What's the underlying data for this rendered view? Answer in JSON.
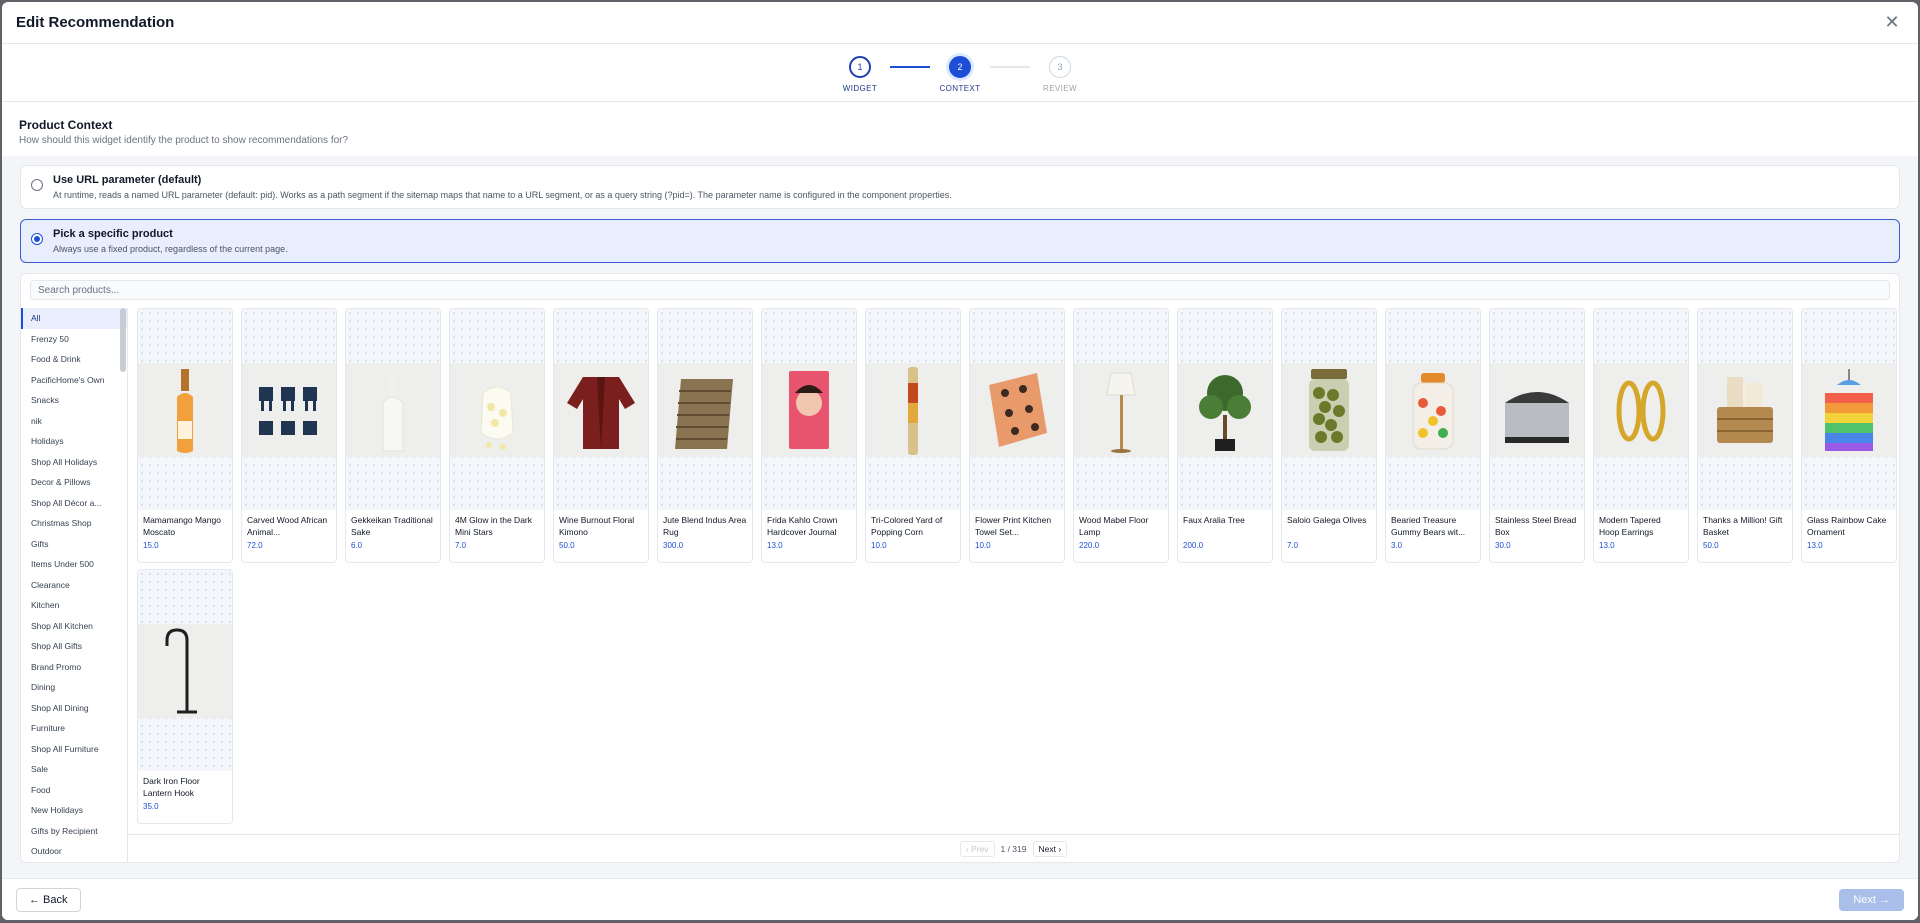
{
  "modal": {
    "title": "Edit Recommendation",
    "close_icon": "close-icon"
  },
  "stepper": {
    "steps": [
      {
        "number": "1",
        "label": "WIDGET",
        "state": "done"
      },
      {
        "number": "2",
        "label": "CONTEXT",
        "state": "active"
      },
      {
        "number": "3",
        "label": "REVIEW",
        "state": "pending"
      }
    ]
  },
  "context": {
    "title": "Product Context",
    "subtitle": "How should this widget identify the product to show recommendations for?"
  },
  "options": [
    {
      "title": "Use URL parameter (default)",
      "description": "At runtime, reads a named URL parameter (default: pid). Works as a path segment if the sitemap maps that name to a URL segment, or as a query string (?pid=). The parameter name is configured in the component properties.",
      "selected": false
    },
    {
      "title": "Pick a specific product",
      "description": "Always use a fixed product, regardless of the current page.",
      "selected": true
    }
  ],
  "search": {
    "placeholder": "Search products...",
    "value": ""
  },
  "categories": [
    "All",
    "Frenzy 50",
    "Food & Drink",
    "PacificHome's Own",
    "Snacks",
    "nik",
    "Holidays",
    "Shop All Holidays",
    "Decor & Pillows",
    "Shop All Décor a...",
    "Christmas Shop",
    "Gifts",
    "Items Under 500",
    "Clearance",
    "Kitchen",
    "Shop All Kitchen",
    "Shop All Gifts",
    "Brand Promo",
    "Dining",
    "Shop All Dining",
    "Furniture",
    "Shop All Furniture",
    "Sale",
    "Food",
    "New Holidays",
    "Gifts by Recipient",
    "Outdoor"
  ],
  "active_category": "All",
  "products": [
    {
      "name": "Mamamango Mango Moscato",
      "price": "15.0",
      "icon": "wine-bottle-icon"
    },
    {
      "name": "Carved Wood African Animal...",
      "price": "72.0",
      "icon": "wooden-animals-icon"
    },
    {
      "name": "Gekkeikan Traditional Sake",
      "price": "6.0",
      "icon": "sake-bottle-icon"
    },
    {
      "name": "4M Glow in the Dark Mini Stars",
      "price": "7.0",
      "icon": "glow-stars-icon"
    },
    {
      "name": "Wine Burnout Floral Kimono",
      "price": "50.0",
      "icon": "kimono-icon"
    },
    {
      "name": "Jute Blend Indus Area Rug",
      "price": "300.0",
      "icon": "rug-icon"
    },
    {
      "name": "Frida Kahlo Crown Hardcover Journal",
      "price": "13.0",
      "icon": "journal-icon"
    },
    {
      "name": "Tri-Colored Yard of Popping Corn",
      "price": "10.0",
      "icon": "popcorn-tube-icon"
    },
    {
      "name": "Flower Print Kitchen Towel Set...",
      "price": "10.0",
      "icon": "kitchen-towel-icon"
    },
    {
      "name": "Wood Mabel Floor Lamp",
      "price": "220.0",
      "icon": "floor-lamp-icon"
    },
    {
      "name": "Faux Aralia Tree",
      "price": "200.0",
      "icon": "tree-icon"
    },
    {
      "name": "Saloio Galega Olives",
      "price": "7.0",
      "icon": "olive-jar-icon"
    },
    {
      "name": "Bearied Treasure Gummy Bears wit...",
      "price": "3.0",
      "icon": "gummy-jar-icon"
    },
    {
      "name": "Stainless Steel Bread Box",
      "price": "30.0",
      "icon": "bread-box-icon"
    },
    {
      "name": "Modern Tapered Hoop Earrings",
      "price": "13.0",
      "icon": "earrings-icon"
    },
    {
      "name": "Thanks a Million! Gift Basket",
      "price": "50.0",
      "icon": "gift-basket-icon"
    },
    {
      "name": "Glass Rainbow Cake Ornament",
      "price": "13.0",
      "icon": "cake-ornament-icon"
    },
    {
      "name": "Dark Iron Floor Lantern Hook",
      "price": "35.0",
      "icon": "lantern-hook-icon"
    }
  ],
  "pagination": {
    "prev": "‹ Prev",
    "info": "1 / 319",
    "next": "Next ›"
  },
  "footer": {
    "back": "← Back",
    "next": "Next →"
  },
  "colors": {
    "accent": "#1d4ed8",
    "selected_bg": "#e8eefc",
    "next_disabled": "#a9bfe9"
  }
}
